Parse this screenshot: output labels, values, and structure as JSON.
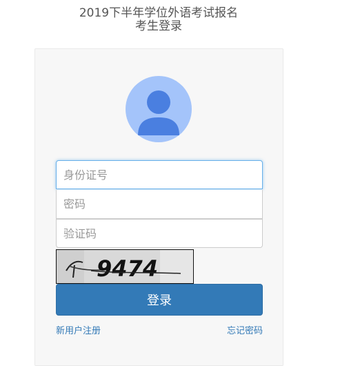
{
  "heading": {
    "title": "2019下半年学位外语考试报名",
    "subtitle": "考生登录"
  },
  "avatar": {
    "icon": "user-avatar-icon",
    "bg_color": "#a4c4fa",
    "figure_color": "#4a7fe0"
  },
  "form": {
    "id_placeholder": "身份证号",
    "password_placeholder": "密码",
    "captcha_placeholder": "验证码",
    "captcha_text": "9474",
    "login_label": "登录"
  },
  "links": {
    "register": "新用户注册",
    "forgot": "忘记密码"
  },
  "colors": {
    "primary": "#337ab7",
    "focus_border": "#66afe9"
  }
}
